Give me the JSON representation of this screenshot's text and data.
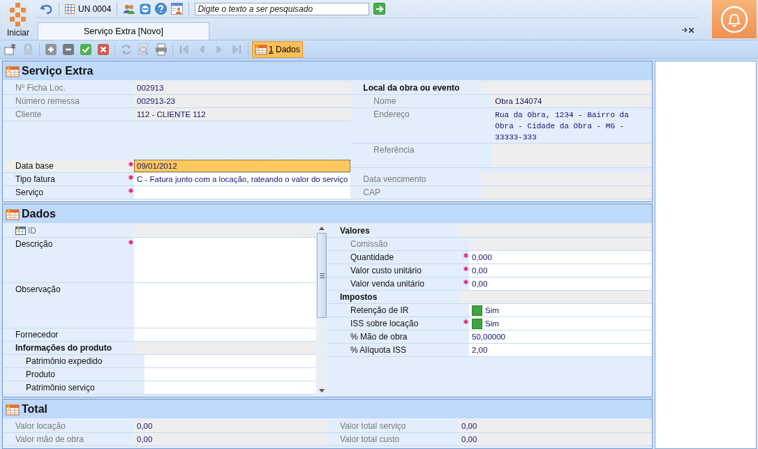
{
  "app": {
    "start_label": "Iniciar"
  },
  "top_toolbar": {
    "unit": "UN 0004",
    "search": {
      "placeholder": "Digite o texto a ser pesquisado"
    }
  },
  "tabs": [
    {
      "label": "Serviço Extra [Novo]",
      "selected": true
    }
  ],
  "toolbar": {
    "buttons": [
      {
        "kind": "new",
        "disabled": false
      },
      {
        "kind": "lock",
        "disabled": true
      },
      {
        "kind": "add",
        "disabled": false
      },
      {
        "kind": "remove",
        "disabled": false
      },
      {
        "kind": "confirm",
        "disabled": false
      },
      {
        "kind": "cancel",
        "disabled": false
      },
      {
        "kind": "refresh",
        "disabled": true
      },
      {
        "kind": "preview",
        "disabled": true
      },
      {
        "kind": "print",
        "disabled": false
      },
      {
        "kind": "first",
        "disabled": true
      },
      {
        "kind": "prev",
        "disabled": true
      },
      {
        "kind": "next",
        "disabled": true
      },
      {
        "kind": "last",
        "disabled": true
      }
    ],
    "views": [
      {
        "hotkey": "1",
        "label": "Dados",
        "selected": true
      }
    ]
  },
  "sections": [
    {
      "title": "Serviço Extra",
      "columns": [
        {
          "kind": "plain",
          "blocks": [
            {
              "rows": [
                {
                  "label": "Nº Ficha Loc.",
                  "value": "002913",
                  "kind": "readonly",
                  "required": false
                },
                {
                  "label": "Número remessa",
                  "value": "002913-23",
                  "kind": "readonly",
                  "required": false
                },
                {
                  "label": "Cliente",
                  "value": "112 - CLIENTE  112",
                  "kind": "readonly",
                  "required": false
                }
              ]
            },
            {
              "rows": [
                {
                  "label": "Data base",
                  "value": "09/01/2012",
                  "kind": "focused",
                  "required": true
                },
                {
                  "label": "Tipo fatura",
                  "value": "C - Fatura junto com a locação, rateando o valor do serviço",
                  "kind": "input",
                  "required": true
                },
                {
                  "label": "Serviço",
                  "kind": "input",
                  "required": true
                }
              ]
            }
          ]
        },
        {
          "kind": "plain",
          "blocks": [
            {
              "rows": [
                {
                  "label": "Local da obra ou evento",
                  "kind": "group",
                  "required": false,
                  "children": [
                    {
                      "label": "Nome",
                      "value": "Obra 134074",
                      "kind": "readonly",
                      "required": false
                    },
                    {
                      "label": "Endereço",
                      "value": "Rua da Obra, 1234 - Bairro da Obra - Cidade da Obra - MG - 33333-333",
                      "kind": "address",
                      "required": false
                    },
                    {
                      "label": "Referência",
                      "kind": "note",
                      "required": false
                    }
                  ]
                }
              ]
            },
            {
              "rows": [
                {
                  "label": "Data vencimento",
                  "kind": "readonly",
                  "required": false
                },
                {
                  "label": "CAP",
                  "kind": "readonly",
                  "required": false
                }
              ]
            }
          ]
        }
      ]
    },
    {
      "title": "Dados",
      "columns": [
        {
          "kind": "scroll",
          "blocks": [
            {
              "rows": [
                {
                  "label": "ID",
                  "kind": "key",
                  "required": false
                },
                {
                  "label": "Descrição",
                  "kind": "memo",
                  "required": true
                },
                {
                  "label": "Observação",
                  "kind": "memo",
                  "required": false
                },
                {
                  "label": "Fornecedor",
                  "kind": "input",
                  "required": false
                },
                {
                  "label": "Informações do produto",
                  "kind": "group",
                  "required": false,
                  "children": [
                    {
                      "label": "Patrimônio expedido",
                      "kind": "input",
                      "required": false
                    },
                    {
                      "label": "Produto",
                      "kind": "input",
                      "required": false
                    },
                    {
                      "label": "Patrimônio serviço",
                      "kind": "input",
                      "required": false
                    }
                  ]
                }
              ]
            }
          ]
        },
        {
          "kind": "plain",
          "blocks": [
            {
              "rows": [
                {
                  "label": "Valores",
                  "kind": "group",
                  "required": false,
                  "children": [
                    {
                      "label": "Comissão",
                      "kind": "readonly",
                      "required": false
                    },
                    {
                      "label": "Quantidade",
                      "value": "0,000",
                      "kind": "input",
                      "required": true
                    },
                    {
                      "label": "Valor custo unitário",
                      "value": "0,00",
                      "kind": "input",
                      "required": true
                    },
                    {
                      "label": "Valor venda unitário",
                      "value": "0,00",
                      "kind": "input",
                      "required": true
                    }
                  ]
                },
                {
                  "label": "Impostos",
                  "kind": "group",
                  "required": false,
                  "children": [
                    {
                      "label": "Retenção de IR",
                      "value": "Sim",
                      "kind": "toggle",
                      "on": true,
                      "required": false
                    },
                    {
                      "label": "ISS sobre locação",
                      "value": "Sim",
                      "kind": "toggle",
                      "on": true,
                      "required": true
                    },
                    {
                      "label": "% Mão de obra",
                      "value": "50,00000",
                      "kind": "input",
                      "required": false
                    },
                    {
                      "label": "% Alíquota ISS",
                      "value": "2,00",
                      "kind": "input",
                      "required": false
                    }
                  ]
                }
              ]
            }
          ]
        }
      ]
    },
    {
      "title": "Total",
      "columns": [
        {
          "kind": "plain",
          "blocks": [
            {
              "rows": [
                {
                  "label": "Valor locação",
                  "value": "0,00",
                  "kind": "readonly",
                  "required": false
                },
                {
                  "label": "Valor mão de obra",
                  "value": "0,00",
                  "kind": "readonly",
                  "required": false
                }
              ]
            }
          ]
        },
        {
          "kind": "plain",
          "blocks": [
            {
              "rows": [
                {
                  "label": "Valor total serviço",
                  "value": "0,00",
                  "kind": "readonly",
                  "required": false
                },
                {
                  "label": "Valor total custo",
                  "value": "0,00",
                  "kind": "readonly",
                  "required": false
                }
              ]
            }
          ]
        }
      ]
    }
  ]
}
